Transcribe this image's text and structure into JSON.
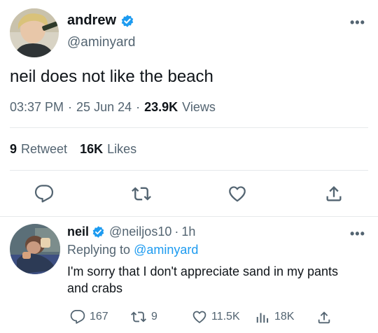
{
  "main_tweet": {
    "author_name": "andrew",
    "author_handle": "@aminyard",
    "text": "neil does not like the beach",
    "time": "03:37 PM",
    "date": "25 Jun 24",
    "dot": "·",
    "views_count": "23.9K",
    "views_label": "Views",
    "retweets_count": "9",
    "retweets_label": "Retweet",
    "likes_count": "16K",
    "likes_label": "Likes",
    "more": "•••",
    "actions": [
      "reply-icon",
      "retweet-icon",
      "like-icon",
      "share-icon"
    ]
  },
  "reply_tweet": {
    "author_name": "neil",
    "author_handle": "@neiljos10",
    "sep": "·",
    "time": "1h",
    "replying_prefix": "Replying to",
    "replying_to": "@aminyard",
    "text": "I'm sorry that I don't appreciate sand in my pants and crabs",
    "more": "•••",
    "reply_count": "167",
    "retweet_count": "9",
    "like_count": "11.5K",
    "view_count": "18K"
  },
  "colors": {
    "text": "#0f1419",
    "secondary": "#536471",
    "accent": "#1d9bf0",
    "divider": "#e6e9eb"
  }
}
